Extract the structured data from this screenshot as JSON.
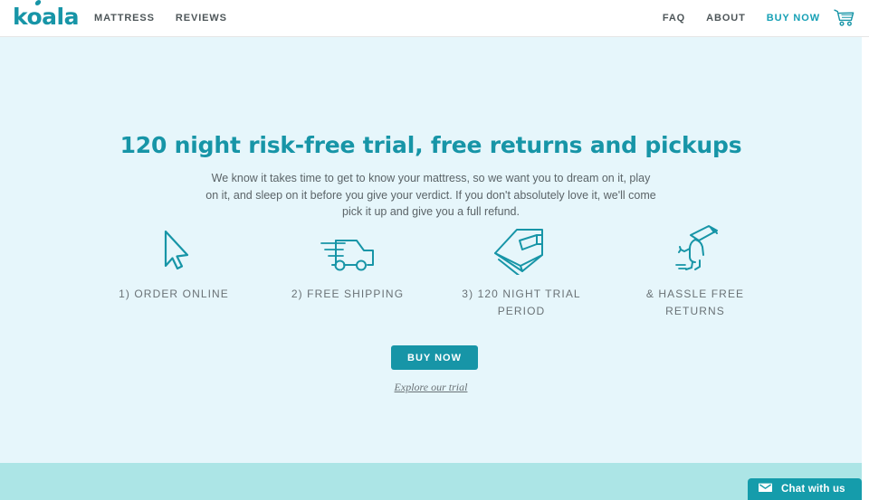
{
  "header": {
    "logo_text": "koala",
    "logo_icon": "koala-wordmark",
    "nav_left": [
      {
        "label": "MATTRESS",
        "name": "nav-link-mattress"
      },
      {
        "label": "REVIEWS",
        "name": "nav-link-reviews"
      }
    ],
    "nav_right": [
      {
        "label": "FAQ",
        "name": "nav-link-faq",
        "accent": false
      },
      {
        "label": "ABOUT",
        "name": "nav-link-about",
        "accent": false
      },
      {
        "label": "BUY NOW",
        "name": "nav-link-buy-now",
        "accent": true
      }
    ],
    "cart_icon": "shopping-cart-icon"
  },
  "hero": {
    "title": "120 night risk-free trial, free returns and pickups",
    "body": "We know it takes time to get to know your mattress, so we want you to dream on it, play on it, and sleep on it before you give your verdict. If you don't absolutely love it, we'll come pick it up and give you a full refund.",
    "cta_button": "BUY NOW",
    "cta_link": "Explore our trial"
  },
  "features": [
    {
      "label": "1) ORDER ONLINE",
      "icon": "cursor-arrow-icon"
    },
    {
      "label": "2) FREE SHIPPING",
      "icon": "delivery-van-icon"
    },
    {
      "label": "3) 120 NIGHT TRIAL PERIOD",
      "icon": "bed-mattress-icon"
    },
    {
      "label": "& HASSLE FREE RETURNS",
      "icon": "person-carrying-mattress-icon"
    }
  ],
  "chat": {
    "label": "Chat with us",
    "icon": "envelope-icon"
  },
  "colors": {
    "teal": "#1795a7",
    "teal_accent": "#16a0b5",
    "hero_background": "#e6f6fb",
    "band": "#ace5e6",
    "body_text": "#5b6468",
    "nav_text": "#4e5659"
  }
}
